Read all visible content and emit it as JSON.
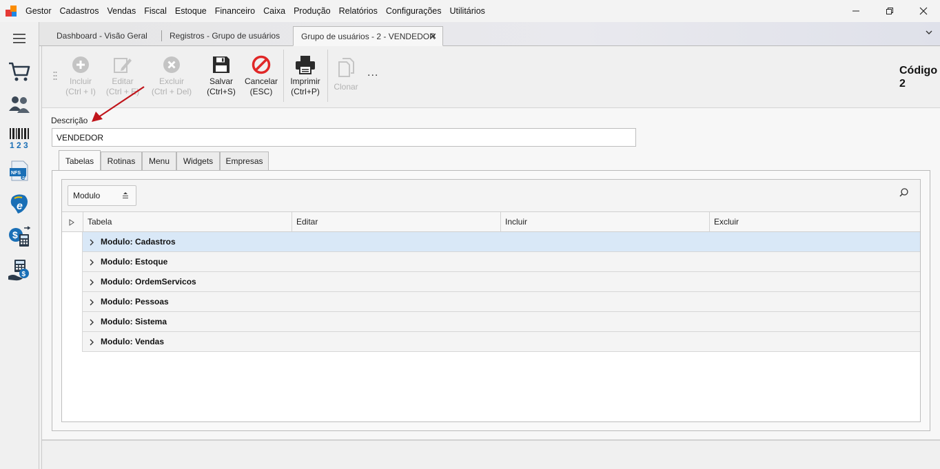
{
  "app": {
    "name": "Gestor"
  },
  "menu": [
    "Cadastros",
    "Vendas",
    "Fiscal",
    "Estoque",
    "Financeiro",
    "Caixa",
    "Produção",
    "Relatórios",
    "Configurações",
    "Utilitários"
  ],
  "window_controls": {
    "minimize": "—",
    "restore": "❐",
    "close": "✕"
  },
  "doc_tabs": [
    {
      "label": "Dashboard - Visão Geral"
    },
    {
      "label": "Registros - Grupo de usuários"
    },
    {
      "label": "Grupo de usuários - 2 - VENDEDOR",
      "close": "✕",
      "active": true
    }
  ],
  "toolbar": {
    "incluir": {
      "label": "Incluir",
      "shortcut": "(Ctrl + I)"
    },
    "editar": {
      "label": "Editar",
      "shortcut": "(Ctrl + E)"
    },
    "excluir": {
      "label": "Excluir",
      "shortcut": "(Ctrl + Del)"
    },
    "salvar": {
      "label": "Salvar",
      "shortcut": "(Ctrl+S)"
    },
    "cancelar": {
      "label": "Cancelar",
      "shortcut": "(ESC)"
    },
    "imprimir": {
      "label": "Imprimir",
      "shortcut": "(Ctrl+P)"
    },
    "clonar": {
      "label": "Clonar"
    },
    "more": "..."
  },
  "codigo": {
    "label": "Código",
    "value": "2"
  },
  "form": {
    "descricao_label": "Descrição",
    "descricao_value": "VENDEDOR"
  },
  "inner_tabs": [
    {
      "label": "Tabelas",
      "active": true
    },
    {
      "label": "Rotinas"
    },
    {
      "label": "Menu"
    },
    {
      "label": "Widgets"
    },
    {
      "label": "Empresas"
    }
  ],
  "grid": {
    "group_by": "Modulo",
    "columns": [
      "Tabela",
      "Editar",
      "Incluir",
      "Excluir"
    ],
    "rows": [
      {
        "label": "Modulo: Cadastros",
        "selected": true
      },
      {
        "label": "Modulo: Estoque"
      },
      {
        "label": "Modulo: OrdemServicos"
      },
      {
        "label": "Modulo: Pessoas"
      },
      {
        "label": "Modulo: Sistema"
      },
      {
        "label": "Modulo: Vendas"
      }
    ]
  },
  "colors": {
    "selected_row": "#d9e8f7",
    "cancel_red": "#e02727",
    "arrow_red": "#c0141a",
    "icon_blue": "#1a6fb6"
  }
}
